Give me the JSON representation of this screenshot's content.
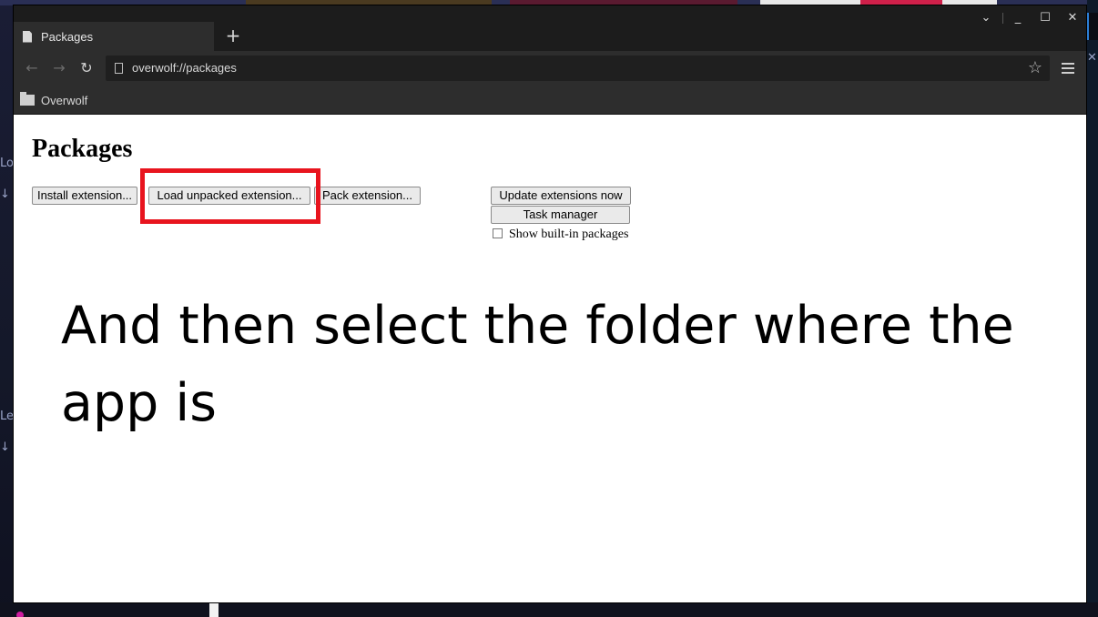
{
  "desktop": {
    "left_texts": [
      "Lo",
      "↓",
      "Le",
      "↓"
    ],
    "close_glyph": "✕"
  },
  "window": {
    "tab": {
      "label": "Packages",
      "icon": "document-icon"
    },
    "new_tab_glyph": "+",
    "controls": {
      "collapse": "⌄",
      "minimize": "_",
      "maximize": "☐",
      "close": "✕"
    },
    "nav": {
      "back": "←",
      "forward": "→",
      "reload": "↻"
    },
    "address": {
      "url": "overwolf://packages",
      "bookmark_icon": "☆"
    },
    "bookmarks_bar": {
      "items": [
        {
          "label": "Overwolf",
          "icon": "folder-icon"
        }
      ]
    }
  },
  "page": {
    "title": "Packages",
    "buttons": {
      "install": "Install extension...",
      "load_unpacked": "Load unpacked extension...",
      "pack": "Pack extension...",
      "update": "Update extensions now",
      "task_manager": "Task manager"
    },
    "builtin_checkbox": {
      "label": "Show built-in packages",
      "checked": false
    },
    "highlight_color": "#e8141e",
    "caption": "And then select the folder where the app is"
  }
}
